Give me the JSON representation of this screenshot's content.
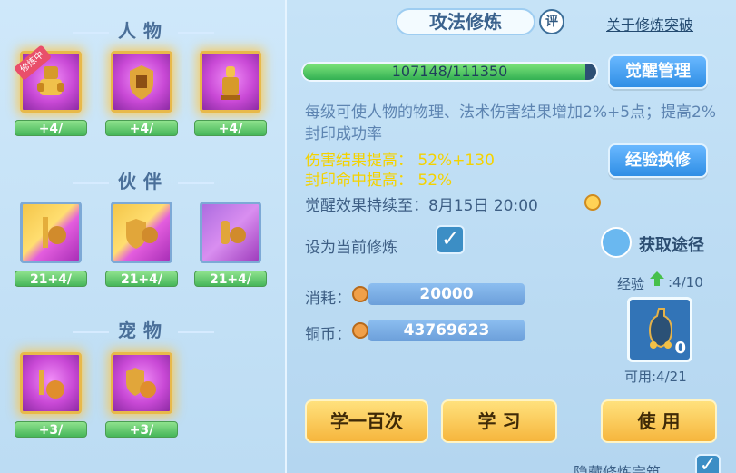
{
  "left": {
    "sections": [
      {
        "title": "人物",
        "skills": [
          {
            "level": "+4/",
            "badge": "修炼中",
            "state": "active"
          },
          {
            "level": "+4/",
            "state": "active"
          },
          {
            "level": "+4/",
            "state": "active"
          }
        ]
      },
      {
        "title": "伙伴",
        "skills": [
          {
            "level": "21+4/",
            "state": "normal"
          },
          {
            "level": "21+4/",
            "state": "normal"
          },
          {
            "level": "21+4/",
            "state": "normal"
          }
        ]
      },
      {
        "title": "宠物",
        "skills": [
          {
            "level": "+3/",
            "state": "active"
          },
          {
            "level": "+3/",
            "state": "active"
          }
        ]
      }
    ]
  },
  "right": {
    "tab_title": "攻法修炼",
    "review_label": "评",
    "breakthrough_link": "关于修炼突破",
    "progress": {
      "text": "107148/111350",
      "value": 107148,
      "max": 111350
    },
    "awaken_button": "觉醒管理",
    "description": "每级可使人物的物理、法术伤害结果增加2%+5点；提高2%封印成功率",
    "effects": [
      {
        "label": "伤害结果提高：",
        "value": "52%+130"
      },
      {
        "label": "封印命中提高：",
        "value": "52%"
      }
    ],
    "expiry_text": "觉醒效果持续至：8月15日 20:00",
    "exchange_button": "经验换修",
    "set_current": {
      "label": "设为当前修炼",
      "checked": true
    },
    "get_path_button": "获取途径",
    "cost": {
      "label": "消耗：",
      "value": "20000"
    },
    "coins": {
      "label": "铜币：",
      "value": "43769623"
    },
    "exp": {
      "label": "经验",
      "count": ":4/10"
    },
    "item": {
      "count": "0",
      "usable": "可用:4/21"
    },
    "buttons": {
      "learn_100": "学一百次",
      "learn": "学 习",
      "use": "使 用"
    },
    "hide_label": "隐藏修炼完筑"
  },
  "colors": {
    "accent": "#2f8ee5",
    "gold": "#f6b63d",
    "effect_text": "#f4d200",
    "progress": "#33b053"
  }
}
